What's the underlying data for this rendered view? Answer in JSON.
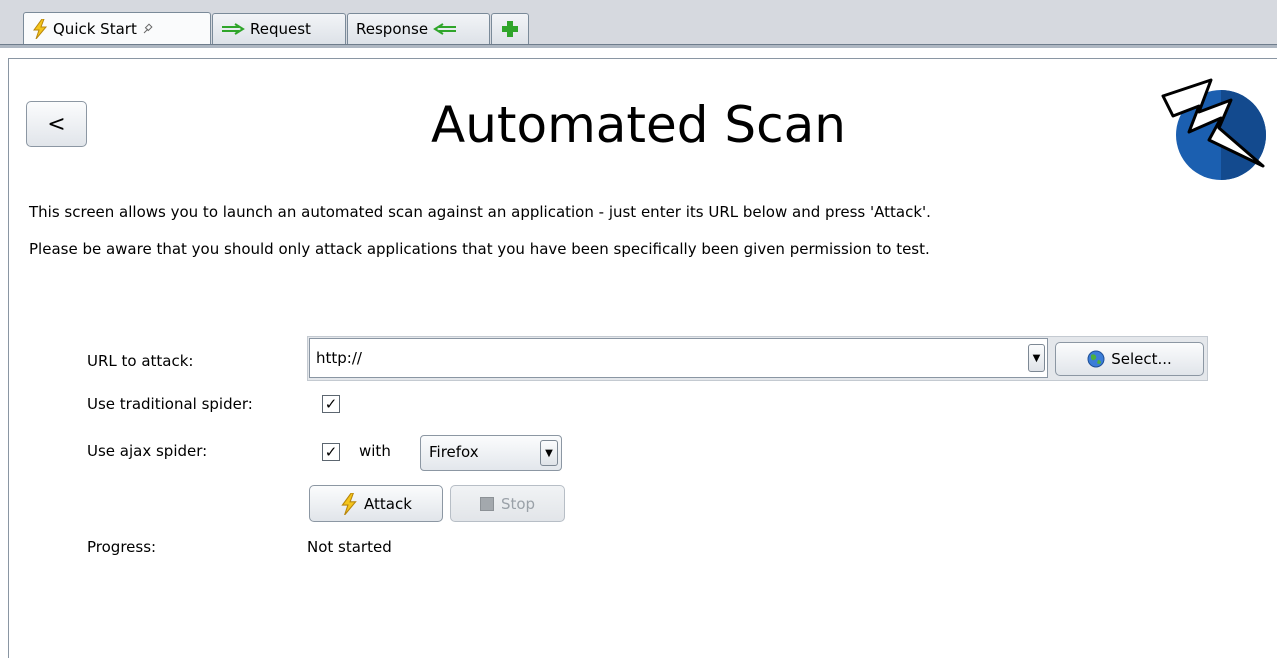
{
  "tabs": [
    {
      "label": "Quick Start",
      "icon": "lightning-icon",
      "pin_icon": "pin-icon",
      "active": true
    },
    {
      "label": "Request",
      "icon": "right-arrow-icon"
    },
    {
      "label": "Response",
      "icon": "left-arrow-icon"
    },
    {
      "label": "",
      "icon": "plus-icon"
    }
  ],
  "header": {
    "back_label": "<",
    "title": "Automated Scan",
    "logo_icon": "zap-lightning-logo"
  },
  "description": {
    "line1": "This screen allows you to launch an automated scan against  an application - just enter its URL below and press 'Attack'.",
    "line2": "Please be aware that you should only attack applications that you have been specifically been given permission to test."
  },
  "form": {
    "url_label": "URL to attack:",
    "url_value": "http://",
    "select_label": "Select...",
    "traditional_label": "Use traditional spider:",
    "traditional_checked": true,
    "ajax_label": "Use ajax spider:",
    "ajax_checked": true,
    "with_label": "with",
    "browser_value": "Firefox",
    "attack_label": "Attack",
    "stop_label": "Stop",
    "progress_label": "Progress:",
    "progress_value": "Not started"
  },
  "colors": {
    "accent_green": "#2fa52a",
    "lightning_yellow": "#f0c419",
    "logo_blue": "#1b5fb0"
  }
}
